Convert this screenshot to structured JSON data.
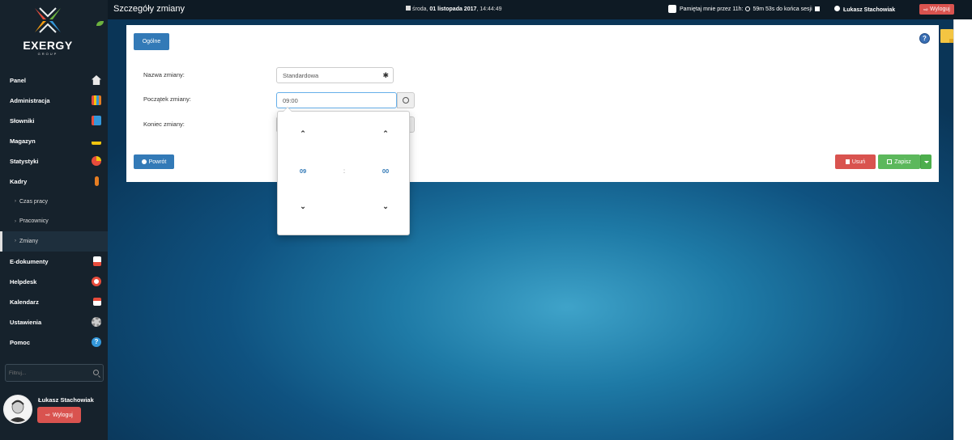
{
  "topbar": {
    "title": "Szczegóły zmiany",
    "date_prefix": "środa, ",
    "date_bold": "01 listopada 2017",
    "date_time": ", 14:44:49",
    "remember": "Pamiętaj mnie przez 11h:",
    "session": "59m 53s  do końca sesji",
    "user": "Łukasz Stachowiak",
    "logout": "Wyloguj"
  },
  "logo": {
    "name": "EXERGY",
    "sub": "GROUP"
  },
  "sidebar": {
    "items": [
      {
        "label": "Panel",
        "icon": "home-icon",
        "color": "#e8e8e8"
      },
      {
        "label": "Administracja",
        "icon": "books-icon",
        "color": "#e67e22"
      },
      {
        "label": "Słowniki",
        "icon": "book-icon",
        "color": "#3498db"
      },
      {
        "label": "Magazyn",
        "icon": "truck-icon",
        "color": "#f1c40f"
      },
      {
        "label": "Statystyki",
        "icon": "pie-chart-icon",
        "color": "#e74c3c"
      },
      {
        "label": "Kadry",
        "icon": "person-icon",
        "color": "#e67e22"
      }
    ],
    "subitems": [
      "Czas pracy",
      "Pracownicy",
      "Zmiany"
    ],
    "items2": [
      {
        "label": "E-dokumenty",
        "icon": "pdf-icon",
        "color": "#e74c3c"
      },
      {
        "label": "Helpdesk",
        "icon": "lifebuoy-icon",
        "color": "#e74c3c"
      },
      {
        "label": "Kalendarz",
        "icon": "calendar-icon",
        "color": "#e74c3c"
      },
      {
        "label": "Ustawienia",
        "icon": "gear-icon",
        "color": "#cccccc"
      },
      {
        "label": "Pomoc",
        "icon": "help-icon",
        "color": "#3498db"
      }
    ],
    "filter_placeholder": "Filtruj...",
    "user_name": "Łukasz Stachowiak",
    "logout": "Wyloguj"
  },
  "panel": {
    "tab": "Ogólne",
    "fields": [
      {
        "label": "Nazwa zmiany:",
        "value": "Standardowa"
      },
      {
        "label": "Początek zmiany:",
        "value": "09:00"
      },
      {
        "label": "Koniec zmiany:",
        "value": ""
      }
    ],
    "back": "Powrót",
    "delete": "Usuń",
    "save": "Zapisz"
  },
  "picker": {
    "hours": "09",
    "sep": ":",
    "minutes": "00"
  }
}
